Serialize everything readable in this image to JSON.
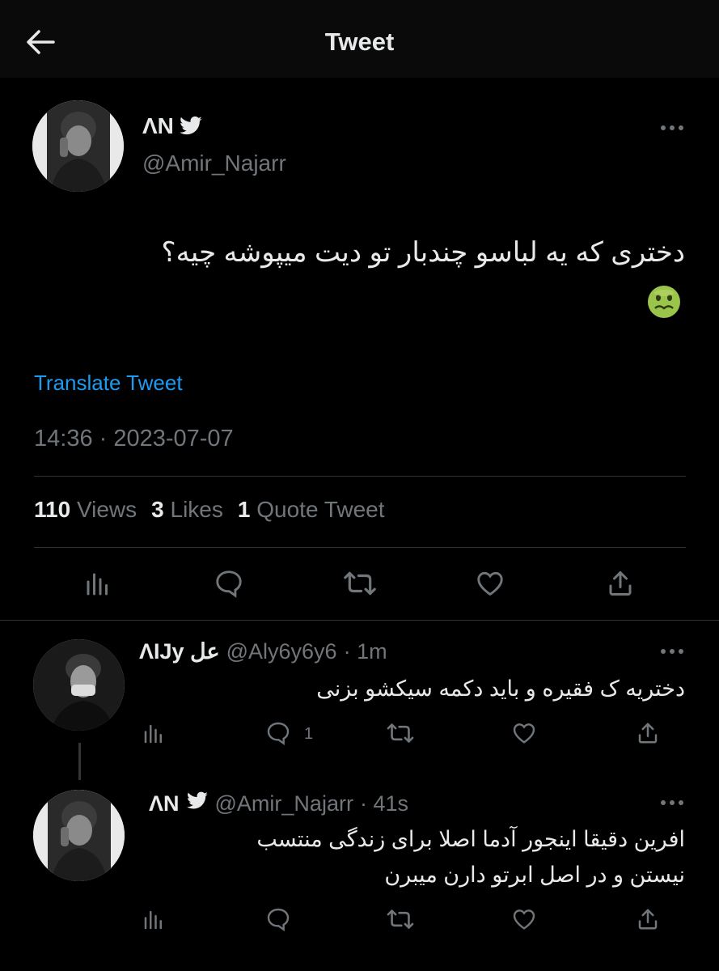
{
  "header": {
    "title": "Tweet",
    "back_icon": "arrow-left-icon"
  },
  "main_tweet": {
    "display_name": "ΛN",
    "handle": "@Amir_Najarr",
    "text": "دختری که یه لباسو چندبار تو دیت میپوشه چیه؟",
    "emoji": "nauseated-face-emoji",
    "translate_label": "Translate Tweet",
    "timestamp": "14:36 · 2023-07-07",
    "stats": {
      "views_count": "110",
      "views_label": "Views",
      "likes_count": "3",
      "likes_label": "Likes",
      "quotes_count": "1",
      "quotes_label": "Quote Tweet"
    }
  },
  "replies": [
    {
      "display_name": "ΛIJy عل",
      "handle": "@Aly6y6y6",
      "time": "· 1m",
      "text": "دختریه ک فقیره و باید دکمه سیکشو بزنی",
      "reply_count": "1"
    },
    {
      "display_name": "ΛN",
      "handle": "@Amir_Najarr",
      "time": "· 41s",
      "text_line1": "افرین دقیقا اینجور آدما اصلا برای زندگی منتسب",
      "text_line2": "نیستن و در اصل ابرتو دارن میبرن",
      "reply_count": ""
    }
  ],
  "colors": {
    "background": "#000000",
    "text": "#e7e9ea",
    "muted": "#71767b",
    "link": "#1d9bf0",
    "divider": "#2f3336"
  }
}
